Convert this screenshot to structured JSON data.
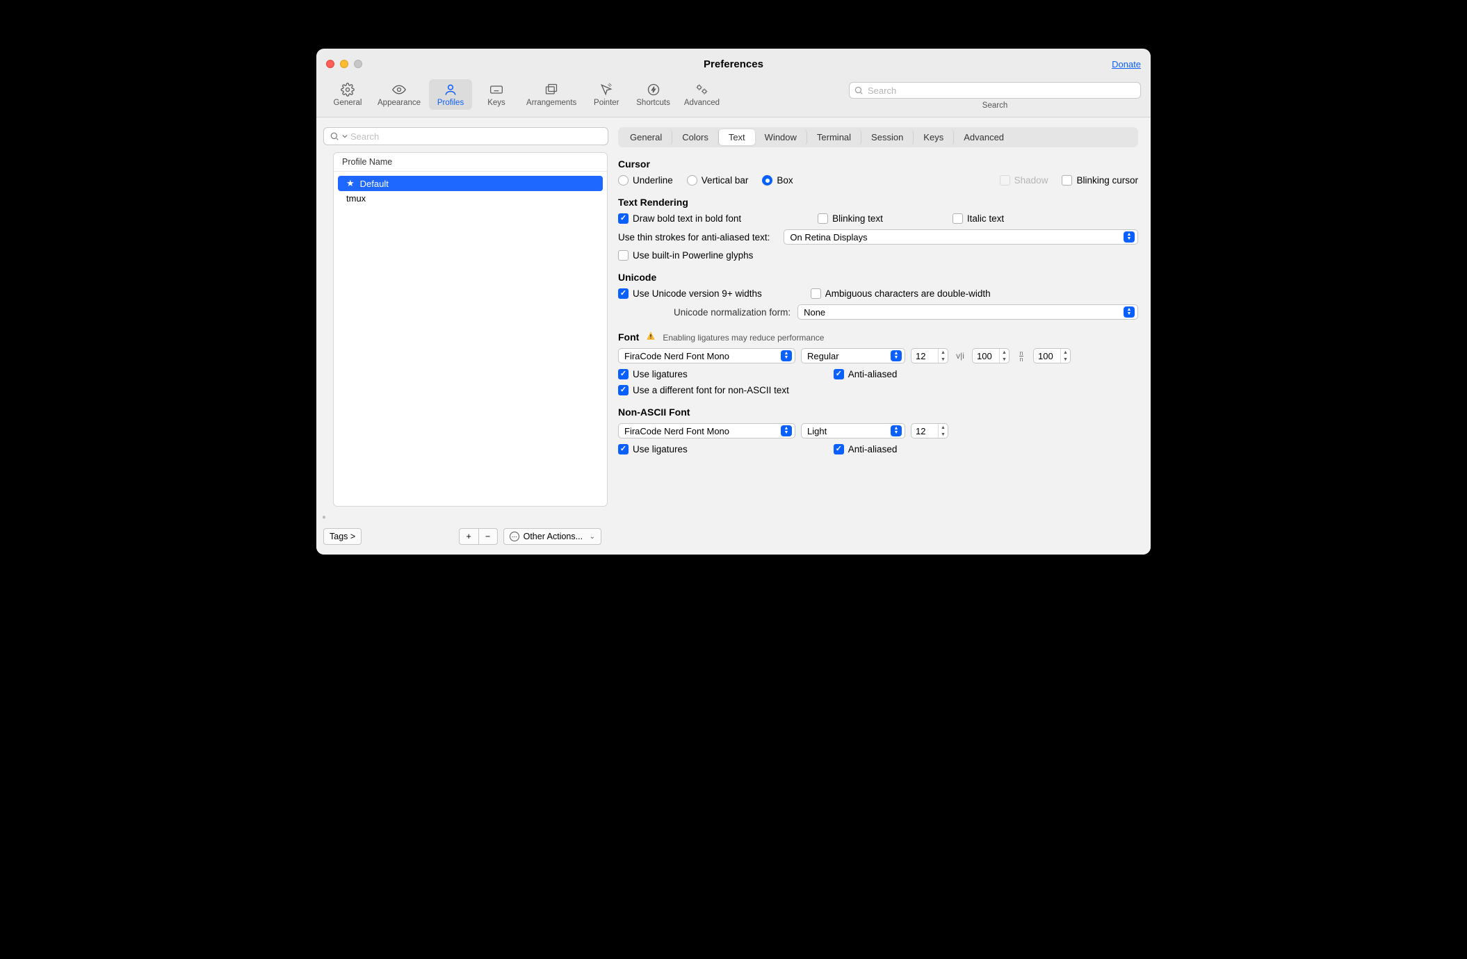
{
  "window": {
    "title": "Preferences",
    "donate": "Donate"
  },
  "toolbar": {
    "items": [
      {
        "label": "General"
      },
      {
        "label": "Appearance"
      },
      {
        "label": "Profiles"
      },
      {
        "label": "Keys"
      },
      {
        "label": "Arrangements"
      },
      {
        "label": "Pointer"
      },
      {
        "label": "Shortcuts"
      },
      {
        "label": "Advanced"
      }
    ],
    "search_placeholder": "Search",
    "search_caption": "Search"
  },
  "sidebar": {
    "search_placeholder": "Search",
    "header": "Profile Name",
    "profiles": [
      {
        "name": "Default",
        "star": true,
        "selected": true
      },
      {
        "name": "tmux",
        "star": false,
        "selected": false
      }
    ],
    "tags_label": "Tags >",
    "other_actions": "Other Actions..."
  },
  "subtabs": [
    "General",
    "Colors",
    "Text",
    "Window",
    "Terminal",
    "Session",
    "Keys",
    "Advanced"
  ],
  "active_subtab": "Text",
  "cursor": {
    "heading": "Cursor",
    "underline": "Underline",
    "vertical_bar": "Vertical bar",
    "box": "Box",
    "shadow": "Shadow",
    "blinking": "Blinking cursor",
    "selected": "box"
  },
  "text_rendering": {
    "heading": "Text Rendering",
    "bold": "Draw bold text in bold font",
    "blinking_text": "Blinking text",
    "italic_text": "Italic text",
    "thin_strokes_label": "Use thin strokes for anti-aliased text:",
    "thin_strokes_value": "On Retina Displays",
    "powerline": "Use built-in Powerline glyphs",
    "bold_checked": true,
    "blinking_checked": false,
    "italic_checked": false,
    "powerline_checked": false
  },
  "unicode": {
    "heading": "Unicode",
    "v9widths": "Use Unicode version 9+ widths",
    "ambiguous": "Ambiguous characters are double-width",
    "norm_label": "Unicode normalization form:",
    "norm_value": "None",
    "v9_checked": true,
    "ambiguous_checked": false
  },
  "font": {
    "heading": "Font",
    "warning": "Enabling ligatures may reduce performance",
    "family": "FiraCode Nerd Font Mono",
    "style": "Regular",
    "size": "12",
    "hspacing": "100",
    "vspacing": "100",
    "ligatures": "Use ligatures",
    "antialiased": "Anti-aliased",
    "non_ascii": "Use a different font for non-ASCII text",
    "ligatures_checked": true,
    "antialiased_checked": true,
    "non_ascii_checked": true
  },
  "non_ascii_font": {
    "heading": "Non-ASCII Font",
    "family": "FiraCode Nerd Font Mono",
    "style": "Light",
    "size": "12",
    "ligatures": "Use ligatures",
    "antialiased": "Anti-aliased",
    "ligatures_checked": true,
    "antialiased_checked": true
  }
}
